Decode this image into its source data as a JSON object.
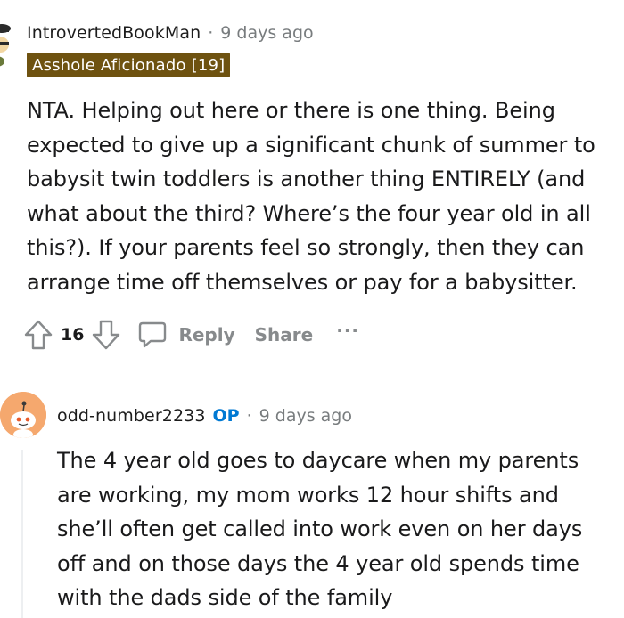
{
  "comment": {
    "author": "IntrovertedBookMan",
    "separator": "·",
    "time": "9 days ago",
    "flair": "Asshole Aficionado [19]",
    "flair_color": "#6e5210",
    "lines": [
      "NTA. Helping out here or there is one thing. Being",
      "expected to give up a significant chunk of summer to",
      "babysit twin toddlers is another thing ENTIRELY (and",
      "what about the third? Where’s the four year old in all",
      "this?). If your parents feel so strongly, then they can",
      "arrange time off themselves or pay for a babysitter."
    ],
    "actions": {
      "upvote_icon": "arrow-up-icon",
      "votes": "16",
      "downvote_icon": "arrow-down-icon",
      "reply_icon": "speech-bubble-icon",
      "reply": "Reply",
      "share": "Share",
      "more": "···"
    }
  },
  "reply": {
    "author": "odd-number2233",
    "op_badge": "OP",
    "op_color": "#0079d3",
    "separator": "·",
    "time": "9 days ago",
    "avatar_icon": "snoo-avatar-icon",
    "avatar_color": "#f5a86e",
    "lines": [
      "The 4 year old goes to daycare when my parents",
      "are working, my mom works 12 hour shifts and",
      "she’ll often get called into work even on her days",
      "off and on those days the 4 year old spends time",
      "with the dads side of the family"
    ]
  }
}
